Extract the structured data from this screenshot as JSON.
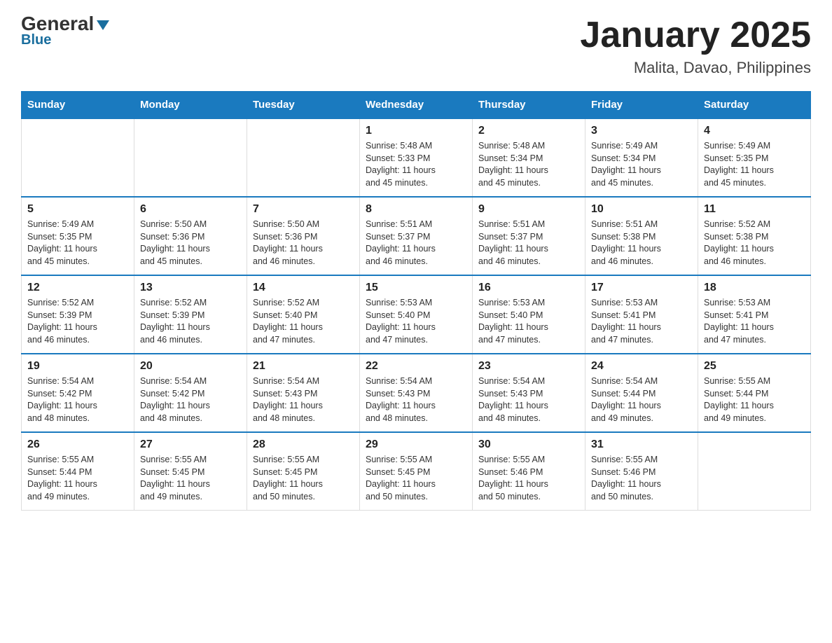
{
  "logo": {
    "general": "General",
    "blue": "Blue"
  },
  "title": "January 2025",
  "subtitle": "Malita, Davao, Philippines",
  "days_of_week": [
    "Sunday",
    "Monday",
    "Tuesday",
    "Wednesday",
    "Thursday",
    "Friday",
    "Saturday"
  ],
  "weeks": [
    [
      {
        "day": "",
        "info": ""
      },
      {
        "day": "",
        "info": ""
      },
      {
        "day": "",
        "info": ""
      },
      {
        "day": "1",
        "info": "Sunrise: 5:48 AM\nSunset: 5:33 PM\nDaylight: 11 hours\nand 45 minutes."
      },
      {
        "day": "2",
        "info": "Sunrise: 5:48 AM\nSunset: 5:34 PM\nDaylight: 11 hours\nand 45 minutes."
      },
      {
        "day": "3",
        "info": "Sunrise: 5:49 AM\nSunset: 5:34 PM\nDaylight: 11 hours\nand 45 minutes."
      },
      {
        "day": "4",
        "info": "Sunrise: 5:49 AM\nSunset: 5:35 PM\nDaylight: 11 hours\nand 45 minutes."
      }
    ],
    [
      {
        "day": "5",
        "info": "Sunrise: 5:49 AM\nSunset: 5:35 PM\nDaylight: 11 hours\nand 45 minutes."
      },
      {
        "day": "6",
        "info": "Sunrise: 5:50 AM\nSunset: 5:36 PM\nDaylight: 11 hours\nand 45 minutes."
      },
      {
        "day": "7",
        "info": "Sunrise: 5:50 AM\nSunset: 5:36 PM\nDaylight: 11 hours\nand 46 minutes."
      },
      {
        "day": "8",
        "info": "Sunrise: 5:51 AM\nSunset: 5:37 PM\nDaylight: 11 hours\nand 46 minutes."
      },
      {
        "day": "9",
        "info": "Sunrise: 5:51 AM\nSunset: 5:37 PM\nDaylight: 11 hours\nand 46 minutes."
      },
      {
        "day": "10",
        "info": "Sunrise: 5:51 AM\nSunset: 5:38 PM\nDaylight: 11 hours\nand 46 minutes."
      },
      {
        "day": "11",
        "info": "Sunrise: 5:52 AM\nSunset: 5:38 PM\nDaylight: 11 hours\nand 46 minutes."
      }
    ],
    [
      {
        "day": "12",
        "info": "Sunrise: 5:52 AM\nSunset: 5:39 PM\nDaylight: 11 hours\nand 46 minutes."
      },
      {
        "day": "13",
        "info": "Sunrise: 5:52 AM\nSunset: 5:39 PM\nDaylight: 11 hours\nand 46 minutes."
      },
      {
        "day": "14",
        "info": "Sunrise: 5:52 AM\nSunset: 5:40 PM\nDaylight: 11 hours\nand 47 minutes."
      },
      {
        "day": "15",
        "info": "Sunrise: 5:53 AM\nSunset: 5:40 PM\nDaylight: 11 hours\nand 47 minutes."
      },
      {
        "day": "16",
        "info": "Sunrise: 5:53 AM\nSunset: 5:40 PM\nDaylight: 11 hours\nand 47 minutes."
      },
      {
        "day": "17",
        "info": "Sunrise: 5:53 AM\nSunset: 5:41 PM\nDaylight: 11 hours\nand 47 minutes."
      },
      {
        "day": "18",
        "info": "Sunrise: 5:53 AM\nSunset: 5:41 PM\nDaylight: 11 hours\nand 47 minutes."
      }
    ],
    [
      {
        "day": "19",
        "info": "Sunrise: 5:54 AM\nSunset: 5:42 PM\nDaylight: 11 hours\nand 48 minutes."
      },
      {
        "day": "20",
        "info": "Sunrise: 5:54 AM\nSunset: 5:42 PM\nDaylight: 11 hours\nand 48 minutes."
      },
      {
        "day": "21",
        "info": "Sunrise: 5:54 AM\nSunset: 5:43 PM\nDaylight: 11 hours\nand 48 minutes."
      },
      {
        "day": "22",
        "info": "Sunrise: 5:54 AM\nSunset: 5:43 PM\nDaylight: 11 hours\nand 48 minutes."
      },
      {
        "day": "23",
        "info": "Sunrise: 5:54 AM\nSunset: 5:43 PM\nDaylight: 11 hours\nand 48 minutes."
      },
      {
        "day": "24",
        "info": "Sunrise: 5:54 AM\nSunset: 5:44 PM\nDaylight: 11 hours\nand 49 minutes."
      },
      {
        "day": "25",
        "info": "Sunrise: 5:55 AM\nSunset: 5:44 PM\nDaylight: 11 hours\nand 49 minutes."
      }
    ],
    [
      {
        "day": "26",
        "info": "Sunrise: 5:55 AM\nSunset: 5:44 PM\nDaylight: 11 hours\nand 49 minutes."
      },
      {
        "day": "27",
        "info": "Sunrise: 5:55 AM\nSunset: 5:45 PM\nDaylight: 11 hours\nand 49 minutes."
      },
      {
        "day": "28",
        "info": "Sunrise: 5:55 AM\nSunset: 5:45 PM\nDaylight: 11 hours\nand 50 minutes."
      },
      {
        "day": "29",
        "info": "Sunrise: 5:55 AM\nSunset: 5:45 PM\nDaylight: 11 hours\nand 50 minutes."
      },
      {
        "day": "30",
        "info": "Sunrise: 5:55 AM\nSunset: 5:46 PM\nDaylight: 11 hours\nand 50 minutes."
      },
      {
        "day": "31",
        "info": "Sunrise: 5:55 AM\nSunset: 5:46 PM\nDaylight: 11 hours\nand 50 minutes."
      },
      {
        "day": "",
        "info": ""
      }
    ]
  ]
}
